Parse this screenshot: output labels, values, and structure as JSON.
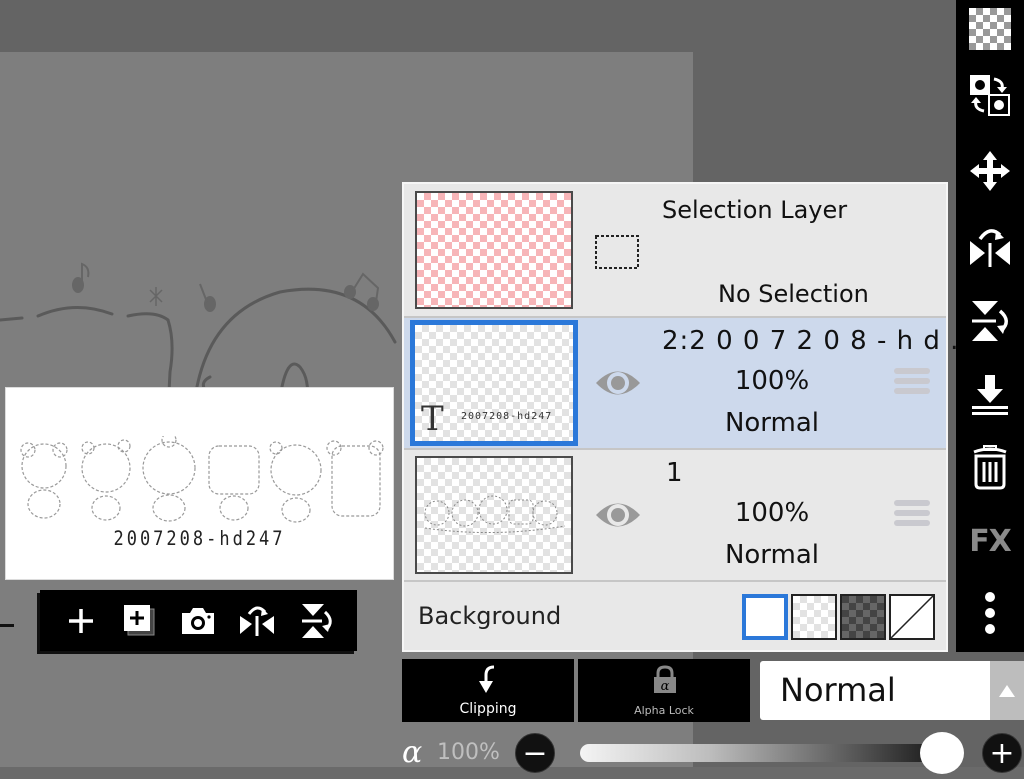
{
  "canvas": {
    "navigator_code_text": "2007208-hd247"
  },
  "layer_toolbar": {
    "buttons": [
      {
        "icon": "add-layer-icon"
      },
      {
        "icon": "add-layer-copy-icon"
      },
      {
        "icon": "camera-icon"
      },
      {
        "icon": "flip-horizontal-icon"
      },
      {
        "icon": "flip-vertical-icon"
      }
    ]
  },
  "right_toolbar": {
    "buttons": [
      {
        "icon": "transparency-checker-icon"
      },
      {
        "icon": "swap-layer-icon"
      },
      {
        "icon": "move-icon"
      },
      {
        "icon": "flip-horizontal-icon"
      },
      {
        "icon": "flip-vertical-icon"
      },
      {
        "icon": "merge-down-icon"
      },
      {
        "icon": "trash-icon"
      },
      {
        "icon": "fx-icon",
        "label": "FX"
      },
      {
        "icon": "more-vertical-icon"
      }
    ]
  },
  "layers": {
    "selection_layer": {
      "title": "Selection Layer",
      "status": "No Selection"
    },
    "items": [
      {
        "name": "2:2 0 0 7 2 0 8 - h d .",
        "opacity": "100%",
        "blend_mode": "Normal",
        "type": "text",
        "selected": true,
        "visible": true,
        "thumb_text": "2007208-hd247"
      },
      {
        "name": "1",
        "opacity": "100%",
        "blend_mode": "Normal",
        "type": "raster",
        "selected": false,
        "visible": true
      }
    ],
    "background": {
      "label": "Background",
      "options": [
        "white",
        "checker-light",
        "checker-dark",
        "none"
      ],
      "selected": "white"
    }
  },
  "bottom_controls": {
    "clipping_label": "Clipping",
    "alpha_lock_label": "Alpha Lock",
    "blend_mode": "Normal",
    "alpha_symbol": "α",
    "opacity_text": "100%",
    "opacity_value": 100,
    "minus_label": "−",
    "plus_label": "+"
  },
  "colors": {
    "accent_blue": "#2b78d9",
    "selected_row": "#cdd9ec",
    "panel_bg": "#e8e8e8",
    "toolbar_bg": "#000000",
    "workspace_bg": "#646464",
    "canvas_bg": "#7e7e7e"
  }
}
